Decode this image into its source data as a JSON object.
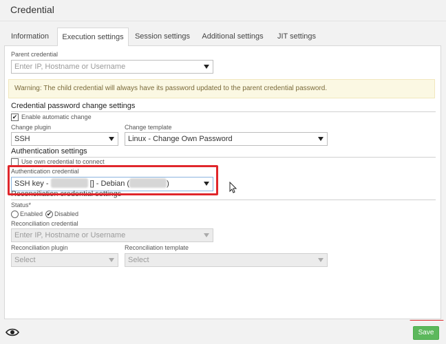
{
  "window": {
    "title": "Credential"
  },
  "tabs": [
    {
      "label": "Information"
    },
    {
      "label": "Execution settings"
    },
    {
      "label": "Session settings"
    },
    {
      "label": "Additional settings"
    },
    {
      "label": "JIT settings"
    }
  ],
  "active_tab": "Execution settings",
  "parent_credential": {
    "label": "Parent credential",
    "placeholder": "Enter IP, Hostname or Username"
  },
  "warning": "Warning: The child credential will always have its password updated to the parent credential password.",
  "password_change": {
    "heading": "Credential password change settings",
    "enable_label": "Enable automatic change",
    "enable_checked": true,
    "plugin_label": "Change plugin",
    "plugin_value": "SSH",
    "template_label": "Change template",
    "template_value": "Linux - Change Own Password"
  },
  "authentication": {
    "heading": "Authentication settings",
    "use_own_label": "Use own credential to connect",
    "use_own_checked": false,
    "credential_label": "Authentication credential",
    "credential_prefix": "SSH key - ",
    "credential_middle": " [] - Debian (",
    "credential_suffix": ")"
  },
  "reconciliation": {
    "heading": "Reconciliation credential settings",
    "status_label": "Status*",
    "enabled_label": "Enabled",
    "disabled_label": "Disabled",
    "selected_status": "Disabled",
    "credential_label": "Reconciliation credential",
    "credential_placeholder": "Enter IP, Hostname or Username",
    "plugin_label": "Reconciliation plugin",
    "plugin_value": "Select",
    "template_label": "Reconciliation template",
    "template_value": "Select"
  },
  "footer": {
    "save_label": "Save",
    "visibility_icon": "eye-icon"
  },
  "colors": {
    "save_button": "#5cb85c",
    "highlight": "#e0262b",
    "warning_bg": "#fbf8e3"
  }
}
